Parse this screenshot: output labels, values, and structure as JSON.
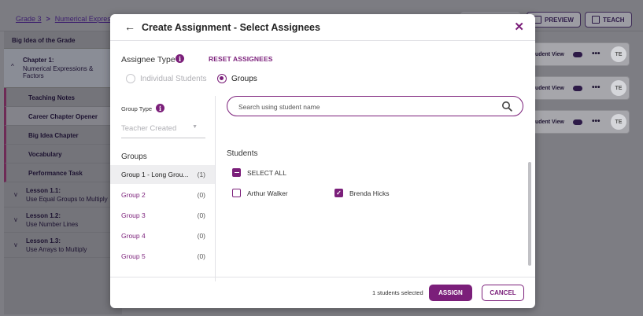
{
  "breadcrumb": {
    "grade": "Grade 3",
    "separator": ">",
    "section": "Numerical Express"
  },
  "toolbar": {
    "preview_label": "PREVIEW",
    "teach_label": "TEACH"
  },
  "sidebar": {
    "header": "Big Idea of the Grade",
    "chapter": {
      "title": "Chapter 1:",
      "subtitle_line1": "Numerical Expressions &",
      "subtitle_line2": "Factors"
    },
    "items": [
      {
        "label": "Teaching Notes"
      },
      {
        "label": "Career Chapter Opener"
      },
      {
        "label": "Big Idea Chapter"
      },
      {
        "label": "Vocabulary"
      },
      {
        "label": "Performance Task"
      }
    ],
    "lessons": [
      {
        "title": "Lesson 1.1:",
        "subtitle": "Use Equal Groups to Multiply"
      },
      {
        "title": "Lesson 1.2:",
        "subtitle": "Use Number Lines"
      },
      {
        "title": "Lesson 1.3:",
        "subtitle": "Use Arrays to Multiply"
      }
    ]
  },
  "cards": [
    {
      "view_label": "udent View",
      "badge": "TE"
    },
    {
      "view_label": "udent View",
      "badge": "TE"
    },
    {
      "view_label": "udent View",
      "badge": "TE"
    }
  ],
  "modal": {
    "title": "Create Assignment - Select Assignees",
    "assignee_type_label": "Assignee Type",
    "reset_label": "RESET ASSIGNEES",
    "radio_individual": "Individual Students",
    "radio_groups": "Groups",
    "group_type_label": "Group Type",
    "group_type_value": "Teacher Created",
    "groups_heading": "Groups",
    "groups": [
      {
        "name": "Group 1 - Long Grou...",
        "count": "(1)"
      },
      {
        "name": "Group 2",
        "count": "(0)"
      },
      {
        "name": "Group 3",
        "count": "(0)"
      },
      {
        "name": "Group 4",
        "count": "(0)"
      },
      {
        "name": "Group 5",
        "count": "(0)"
      }
    ],
    "search_placeholder": "Search using student name",
    "students_heading": "Students",
    "select_all_label": "SELECT ALL",
    "students": [
      {
        "name": "Arthur Walker",
        "checked": false
      },
      {
        "name": "Brenda Hicks",
        "checked": true
      }
    ],
    "selected_count_text": "1 students selected",
    "assign_label": "ASSIGN",
    "cancel_label": "CANCEL"
  },
  "colors": {
    "accent": "#7b1f7a",
    "overlay": "#7d7d83"
  }
}
